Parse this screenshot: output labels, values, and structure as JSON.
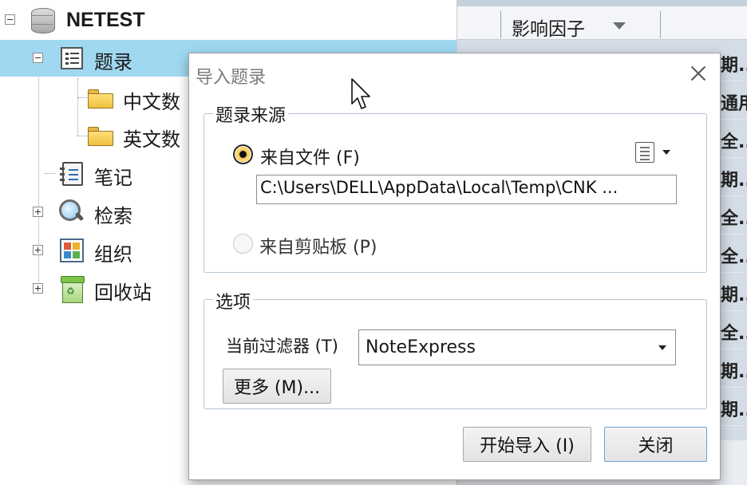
{
  "tree": {
    "root": "NETEST",
    "items": [
      {
        "label": "题录",
        "icon": "list-icon"
      },
      {
        "label": "中文数",
        "icon": "folder-icon"
      },
      {
        "label": "英文数",
        "icon": "folder-icon"
      },
      {
        "label": "笔记",
        "icon": "notebook-icon"
      },
      {
        "label": "检索",
        "icon": "magnifier-icon"
      },
      {
        "label": "组织",
        "icon": "organize-icon"
      },
      {
        "label": "回收站",
        "icon": "recycle-bin-icon"
      }
    ]
  },
  "grid": {
    "column_title": "影响因子",
    "cells": [
      "期...",
      "通用",
      "全...",
      "期...",
      "全...",
      "全...",
      "期...",
      "全...",
      "期...",
      "期..."
    ]
  },
  "dialog": {
    "title": "导入题录",
    "source_group": "题录来源",
    "from_file_label": "来自文件 (F)",
    "file_path": "C:\\Users\\DELL\\AppData\\Local\\Temp\\CNK ...",
    "from_clipboard_label": "来自剪贴板 (P)",
    "options_group": "选项",
    "filter_label": "当前过滤器 (T)",
    "filter_value": "NoteExpress",
    "more_button": "更多 (M)...",
    "start_button": "开始导入 (I)",
    "close_button": "关闭"
  },
  "colors": {
    "selection": "#9fd8f0",
    "grid_background": "#d4dce6",
    "group_border": "#b8c6d6"
  }
}
